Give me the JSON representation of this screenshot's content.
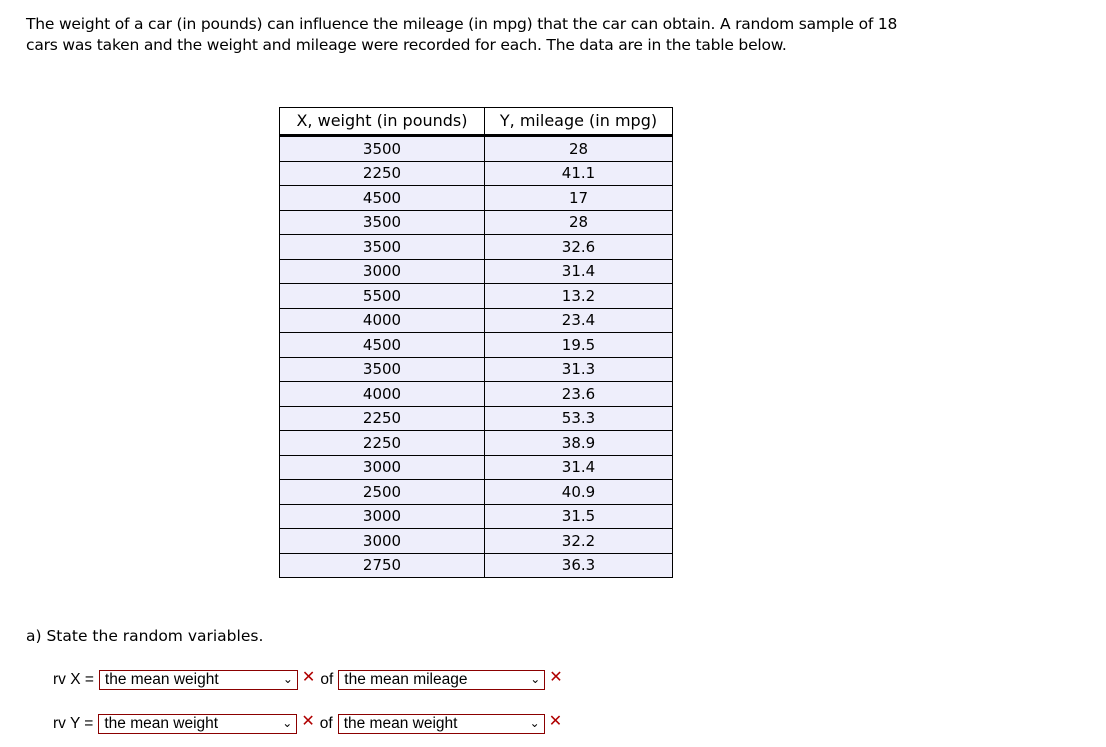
{
  "intro_text": "The weight of a car (in pounds) can influence the mileage (in mpg) that the car can obtain. A random sample of 18 cars was taken and the weight and mileage were recorded for each. The data are in the table below.",
  "table": {
    "headers": [
      "X, weight (in pounds)",
      "Y, mileage (in mpg)"
    ],
    "rows": [
      [
        "3500",
        "28"
      ],
      [
        "2250",
        "41.1"
      ],
      [
        "4500",
        "17"
      ],
      [
        "3500",
        "28"
      ],
      [
        "3500",
        "32.6"
      ],
      [
        "3000",
        "31.4"
      ],
      [
        "5500",
        "13.2"
      ],
      [
        "4000",
        "23.4"
      ],
      [
        "4500",
        "19.5"
      ],
      [
        "3500",
        "31.3"
      ],
      [
        "4000",
        "23.6"
      ],
      [
        "2250",
        "53.3"
      ],
      [
        "2250",
        "38.9"
      ],
      [
        "3000",
        "31.4"
      ],
      [
        "2500",
        "40.9"
      ],
      [
        "3000",
        "31.5"
      ],
      [
        "3000",
        "32.2"
      ],
      [
        "2750",
        "36.3"
      ]
    ]
  },
  "question_a": {
    "prompt": "a) State the random variables.",
    "rows": [
      {
        "label": "rv X =",
        "select1": "the mean weight",
        "of": "of",
        "select2": "the mean mileage",
        "mark": "✕",
        "mark_state": "incorrect"
      },
      {
        "label": "rv Y =",
        "select1": "the mean weight",
        "of": "of",
        "select2": "the mean weight",
        "mark": "✕",
        "mark_state": "incorrect"
      }
    ]
  },
  "colors": {
    "error": "#b00000",
    "select_border": "#8b0000",
    "cell_bg": "#eeeefb"
  }
}
